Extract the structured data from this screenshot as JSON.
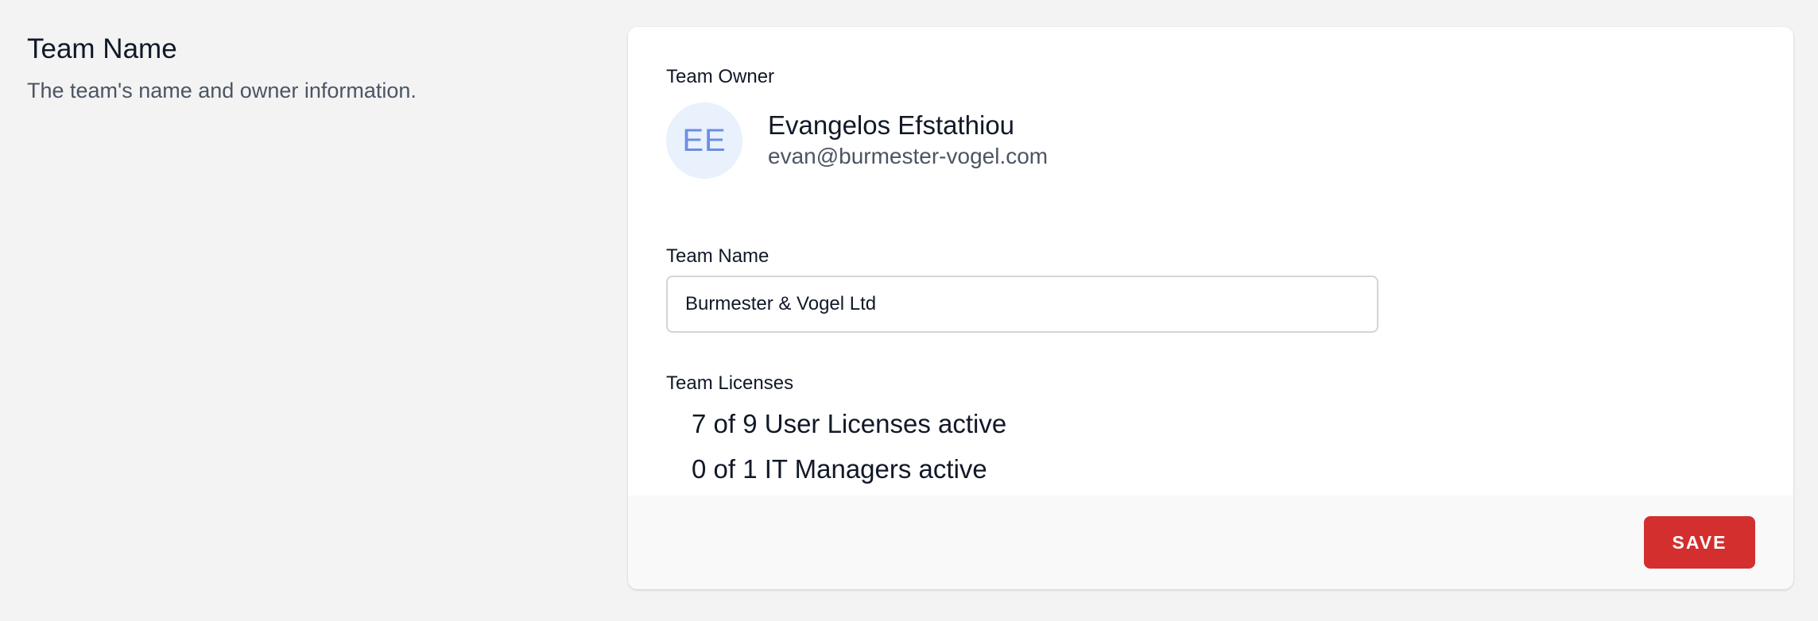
{
  "section": {
    "title": "Team Name",
    "description": "The team's name and owner information."
  },
  "owner": {
    "label": "Team Owner",
    "initials": "EE",
    "name": "Evangelos Efstathiou",
    "email": "evan@burmester-vogel.com"
  },
  "team_name": {
    "label": "Team Name",
    "value": "Burmester & Vogel Ltd"
  },
  "licenses": {
    "label": "Team Licenses",
    "items": [
      "7 of 9 User Licenses active",
      "0 of 1 IT Managers active"
    ]
  },
  "footer": {
    "save_label": "SAVE"
  },
  "colors": {
    "accent_red": "#d32f2f",
    "avatar_bg": "#e8f1fc",
    "avatar_text": "#6b8fe0"
  }
}
